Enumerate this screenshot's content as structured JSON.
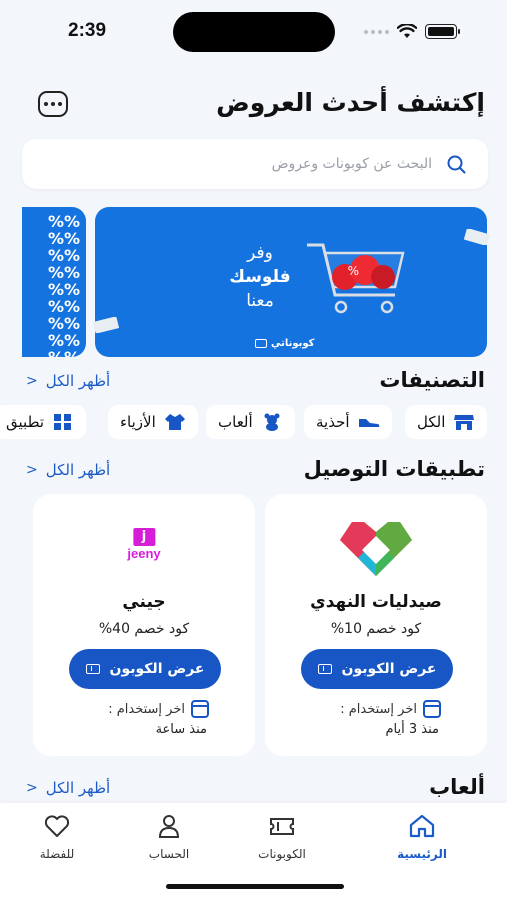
{
  "status": {
    "time": "2:39"
  },
  "header": {
    "title": "إكتشف أحدث العروض"
  },
  "search": {
    "placeholder": "البحث عن كوبونات وعروض"
  },
  "banner": {
    "line1": "وفر",
    "line2": "فلوسك",
    "line3": "معنا",
    "brand": "كوبوناتي",
    "percent_pattern": "%%%%%%%%%%%%%%%%%%%%%%%%"
  },
  "categories": {
    "title": "التصنيفات",
    "see_all": "أظهر الكل",
    "items": [
      {
        "label": "الكل",
        "icon": "store-icon"
      },
      {
        "label": "أحذية",
        "icon": "shoe-icon"
      },
      {
        "label": "ألعاب",
        "icon": "teddy-icon"
      },
      {
        "label": "الأزياء",
        "icon": "fashion-icon"
      },
      {
        "label": "تطبيق",
        "icon": "apps-icon"
      }
    ]
  },
  "delivery": {
    "title": "تطبيقات التوصيل",
    "see_all": "أظهر الكل",
    "cards": [
      {
        "name": "صيدليات النهدي",
        "discount": "كود خصم 10%",
        "button": "عرض الكوبون",
        "last_use_label": "اخر إستخدام :",
        "last_use_value": "منذ 3 أيام"
      },
      {
        "name": "جيني",
        "discount": "كود خصم 40%",
        "button": "عرض الكوبون",
        "last_use_label": "اخر إستخدام :",
        "last_use_value": "منذ ساعة",
        "logo_text": "jeeny",
        "logo_letter": "j"
      }
    ]
  },
  "games": {
    "title": "ألعاب",
    "see_all": "أظهر الكل"
  },
  "tabbar": {
    "items": [
      {
        "label": "الرئيسية",
        "active": true
      },
      {
        "label": "الكوبونات",
        "active": false
      },
      {
        "label": "الحساب",
        "active": false
      },
      {
        "label": "للفضلة",
        "active": false
      }
    ]
  },
  "colors": {
    "accent": "#1756c4",
    "banner": "#1573e0",
    "link": "#1d5bc7",
    "jeeny": "#d61ed8"
  }
}
